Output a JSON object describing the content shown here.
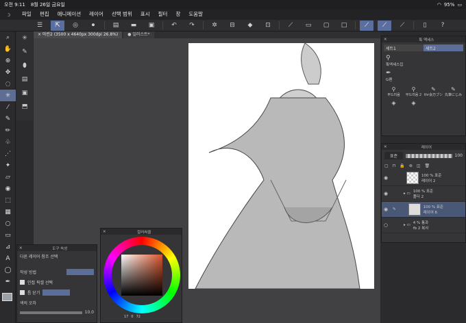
{
  "status": {
    "time": "오전 9:11",
    "date": "8월 26일 금요일",
    "battery": "95%"
  },
  "menu": [
    "파일",
    "편집",
    "애니메이션",
    "레이어",
    "선택 범위",
    "표시",
    "필터",
    "창",
    "도움말"
  ],
  "tabs": [
    {
      "label": "× 아린2 (3500 x 4640px 300dpi 26.8%)"
    },
    {
      "label": "● 일러스트*"
    }
  ],
  "material_panel": {
    "title": "툭 맥세스",
    "tabs": [
      "세트1",
      "세트2"
    ],
    "items": [
      "툭액세스집",
      "G펜"
    ],
    "brushes": [
      "부드러움",
      "부드러움 2",
      "thr会万ブシ",
      "丸筆にじみ"
    ]
  },
  "layer_panel": {
    "title": "레이어",
    "blend": "표준",
    "opacity": "100",
    "layers": [
      {
        "name": "레이어 2",
        "info": "100 % 표준"
      },
      {
        "name": "폴더 2",
        "info": "100 % 표준"
      },
      {
        "name": "레이어 6",
        "info": "100 % 표준"
      },
      {
        "name": "fb 2 복사",
        "info": "4 % 통과"
      }
    ]
  },
  "tool_property": {
    "title": "도구 속성",
    "reference": "다른 레이어 참조 선택",
    "mode_label": "작성 방법",
    "adjacent": "인접 픽셀 선택",
    "gap_close": "틈 닫기",
    "tolerance_label": "색의 오차",
    "tolerance_value": "10.0"
  },
  "color_panel": {
    "title": "컬러써클",
    "h": "17",
    "s": "0",
    "v": "72"
  },
  "colors": {
    "accent": "#5b6d99",
    "bg": "#2b2b2d"
  }
}
